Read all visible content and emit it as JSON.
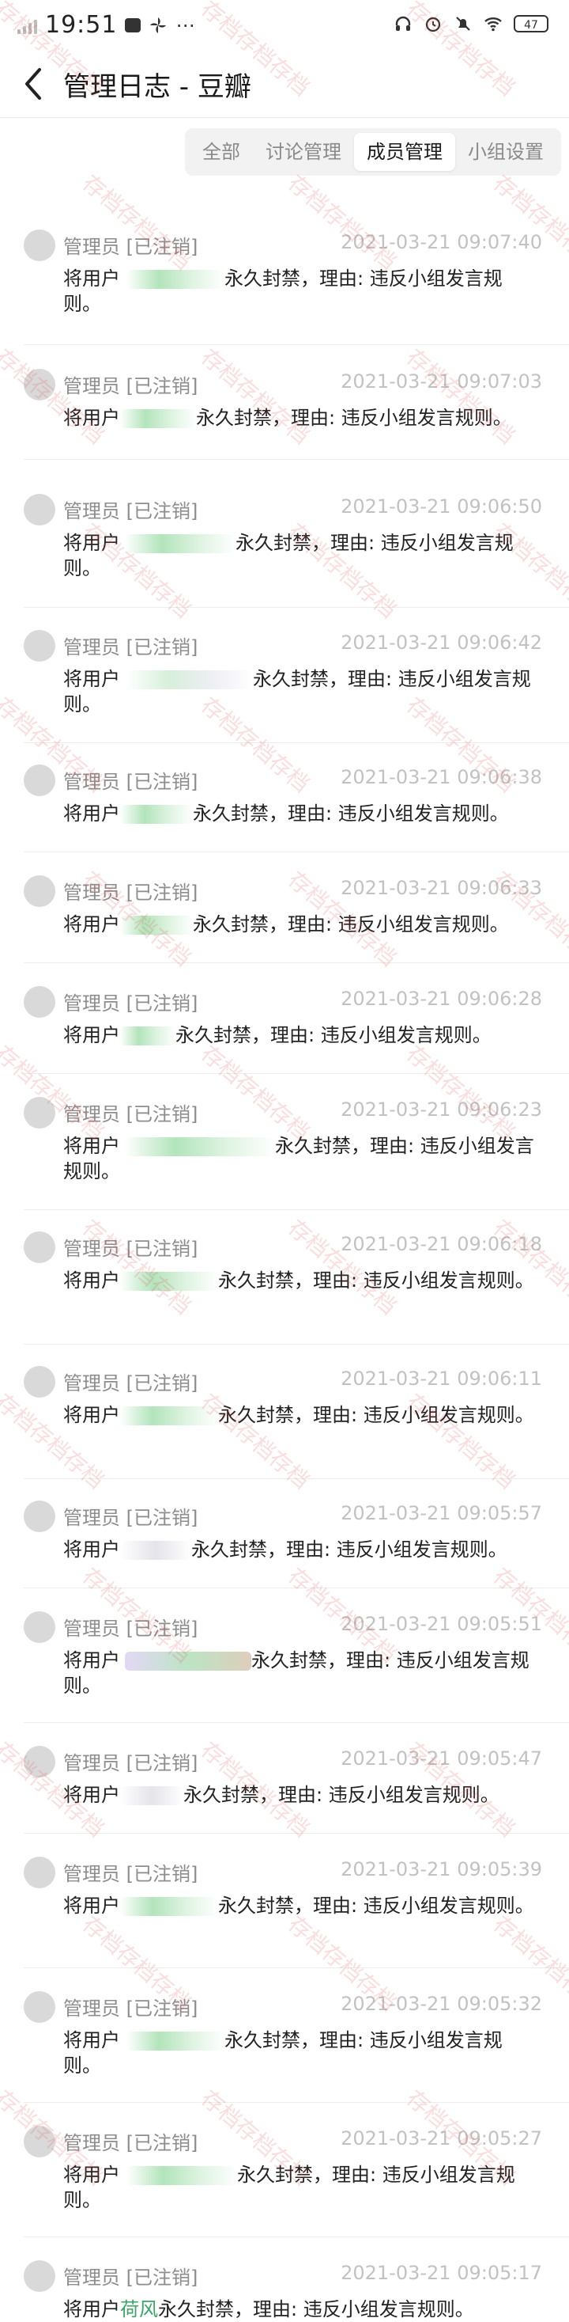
{
  "status_bar": {
    "time": "19:51",
    "battery": "47",
    "icons": [
      "signal-icon",
      "app-icon",
      "pinwheel-icon",
      "more-dots-icon",
      "headphones-icon",
      "alarm-icon",
      "mute-icon",
      "wifi-icon",
      "battery-icon"
    ]
  },
  "header": {
    "title": "管理日志 - 豆瓣",
    "back_icon": "back-arrow-icon"
  },
  "tabs": [
    {
      "label": "全部",
      "active": false
    },
    {
      "label": "讨论管理",
      "active": false
    },
    {
      "label": "成员管理",
      "active": true
    },
    {
      "label": "小组设置",
      "active": false
    }
  ],
  "logs": [
    {
      "actor": "管理员 [已注销]",
      "time": "2021-03-21 09:07:40",
      "pre": "将用户",
      "post": "永久封禁，理由: 违反小组发言规则。"
    },
    {
      "actor": "管理员 [已注销]",
      "time": "2021-03-21 09:07:03",
      "pre": "将用户",
      "post": "永久封禁，理由: 违反小组发言规则。"
    },
    {
      "actor": "管理员 [已注销]",
      "time": "2021-03-21 09:06:50",
      "pre": "将用户",
      "post": "永久封禁，理由: 违反小组发言规则。"
    },
    {
      "actor": "管理员 [已注销]",
      "time": "2021-03-21 09:06:42",
      "pre": "将用户",
      "post": "永久封禁，理由: 违反小组发言规则。"
    },
    {
      "actor": "管理员 [已注销]",
      "time": "2021-03-21 09:06:38",
      "pre": "将用户",
      "post": "永久封禁，理由: 违反小组发言规则。"
    },
    {
      "actor": "管理员 [已注销]",
      "time": "2021-03-21 09:06:33",
      "pre": "将用户",
      "post": "永久封禁，理由: 违反小组发言规则。"
    },
    {
      "actor": "管理员 [已注销]",
      "time": "2021-03-21 09:06:28",
      "pre": "将用户",
      "post": "永久封禁，理由: 违反小组发言规则。"
    },
    {
      "actor": "管理员 [已注销]",
      "time": "2021-03-21 09:06:23",
      "pre": "将用户",
      "post": "永久封禁，理由: 违反小组发言规则。"
    },
    {
      "actor": "管理员 [已注销]",
      "time": "2021-03-21 09:06:18",
      "pre": "将用户",
      "post": "永久封禁，理由: 违反小组发言规则。"
    },
    {
      "actor": "管理员 [已注销]",
      "time": "2021-03-21 09:06:11",
      "pre": "将用户",
      "post": "永久封禁，理由: 违反小组发言规则。"
    },
    {
      "actor": "管理员 [已注销]",
      "time": "2021-03-21 09:05:57",
      "pre": "将用户",
      "post": "永久封禁，理由: 违反小组发言规则。"
    },
    {
      "actor": "管理员 [已注销]",
      "time": "2021-03-21 09:05:51",
      "pre": "将用户",
      "post": "永久封禁，理由: 违反小组发言规则。"
    },
    {
      "actor": "管理员 [已注销]",
      "time": "2021-03-21 09:05:47",
      "pre": "将用户",
      "post": "永久封禁，理由: 违反小组发言规则。"
    },
    {
      "actor": "管理员 [已注销]",
      "time": "2021-03-21 09:05:39",
      "pre": "将用户",
      "post": "永久封禁，理由: 违反小组发言规则。"
    },
    {
      "actor": "管理员 [已注销]",
      "time": "2021-03-21 09:05:32",
      "pre": "将用户",
      "post": "永久封禁，理由: 违反小组发言规则。"
    },
    {
      "actor": "管理员 [已注销]",
      "time": "2021-03-21 09:05:27",
      "pre": "将用户",
      "post": "永久封禁，理由: 违反小组发言规则。"
    },
    {
      "actor": "管理员 [已注销]",
      "time": "2021-03-21 09:05:17",
      "pre": "将用户",
      "name": "荷风",
      "post": "永久封禁，理由: 违反小组发言规则。"
    }
  ],
  "watermark": "存档存档存档",
  "colors": {
    "accent_link": "#3aa566",
    "time_gray": "#c2c2c2",
    "tab_bg": "#f2f2f2"
  }
}
